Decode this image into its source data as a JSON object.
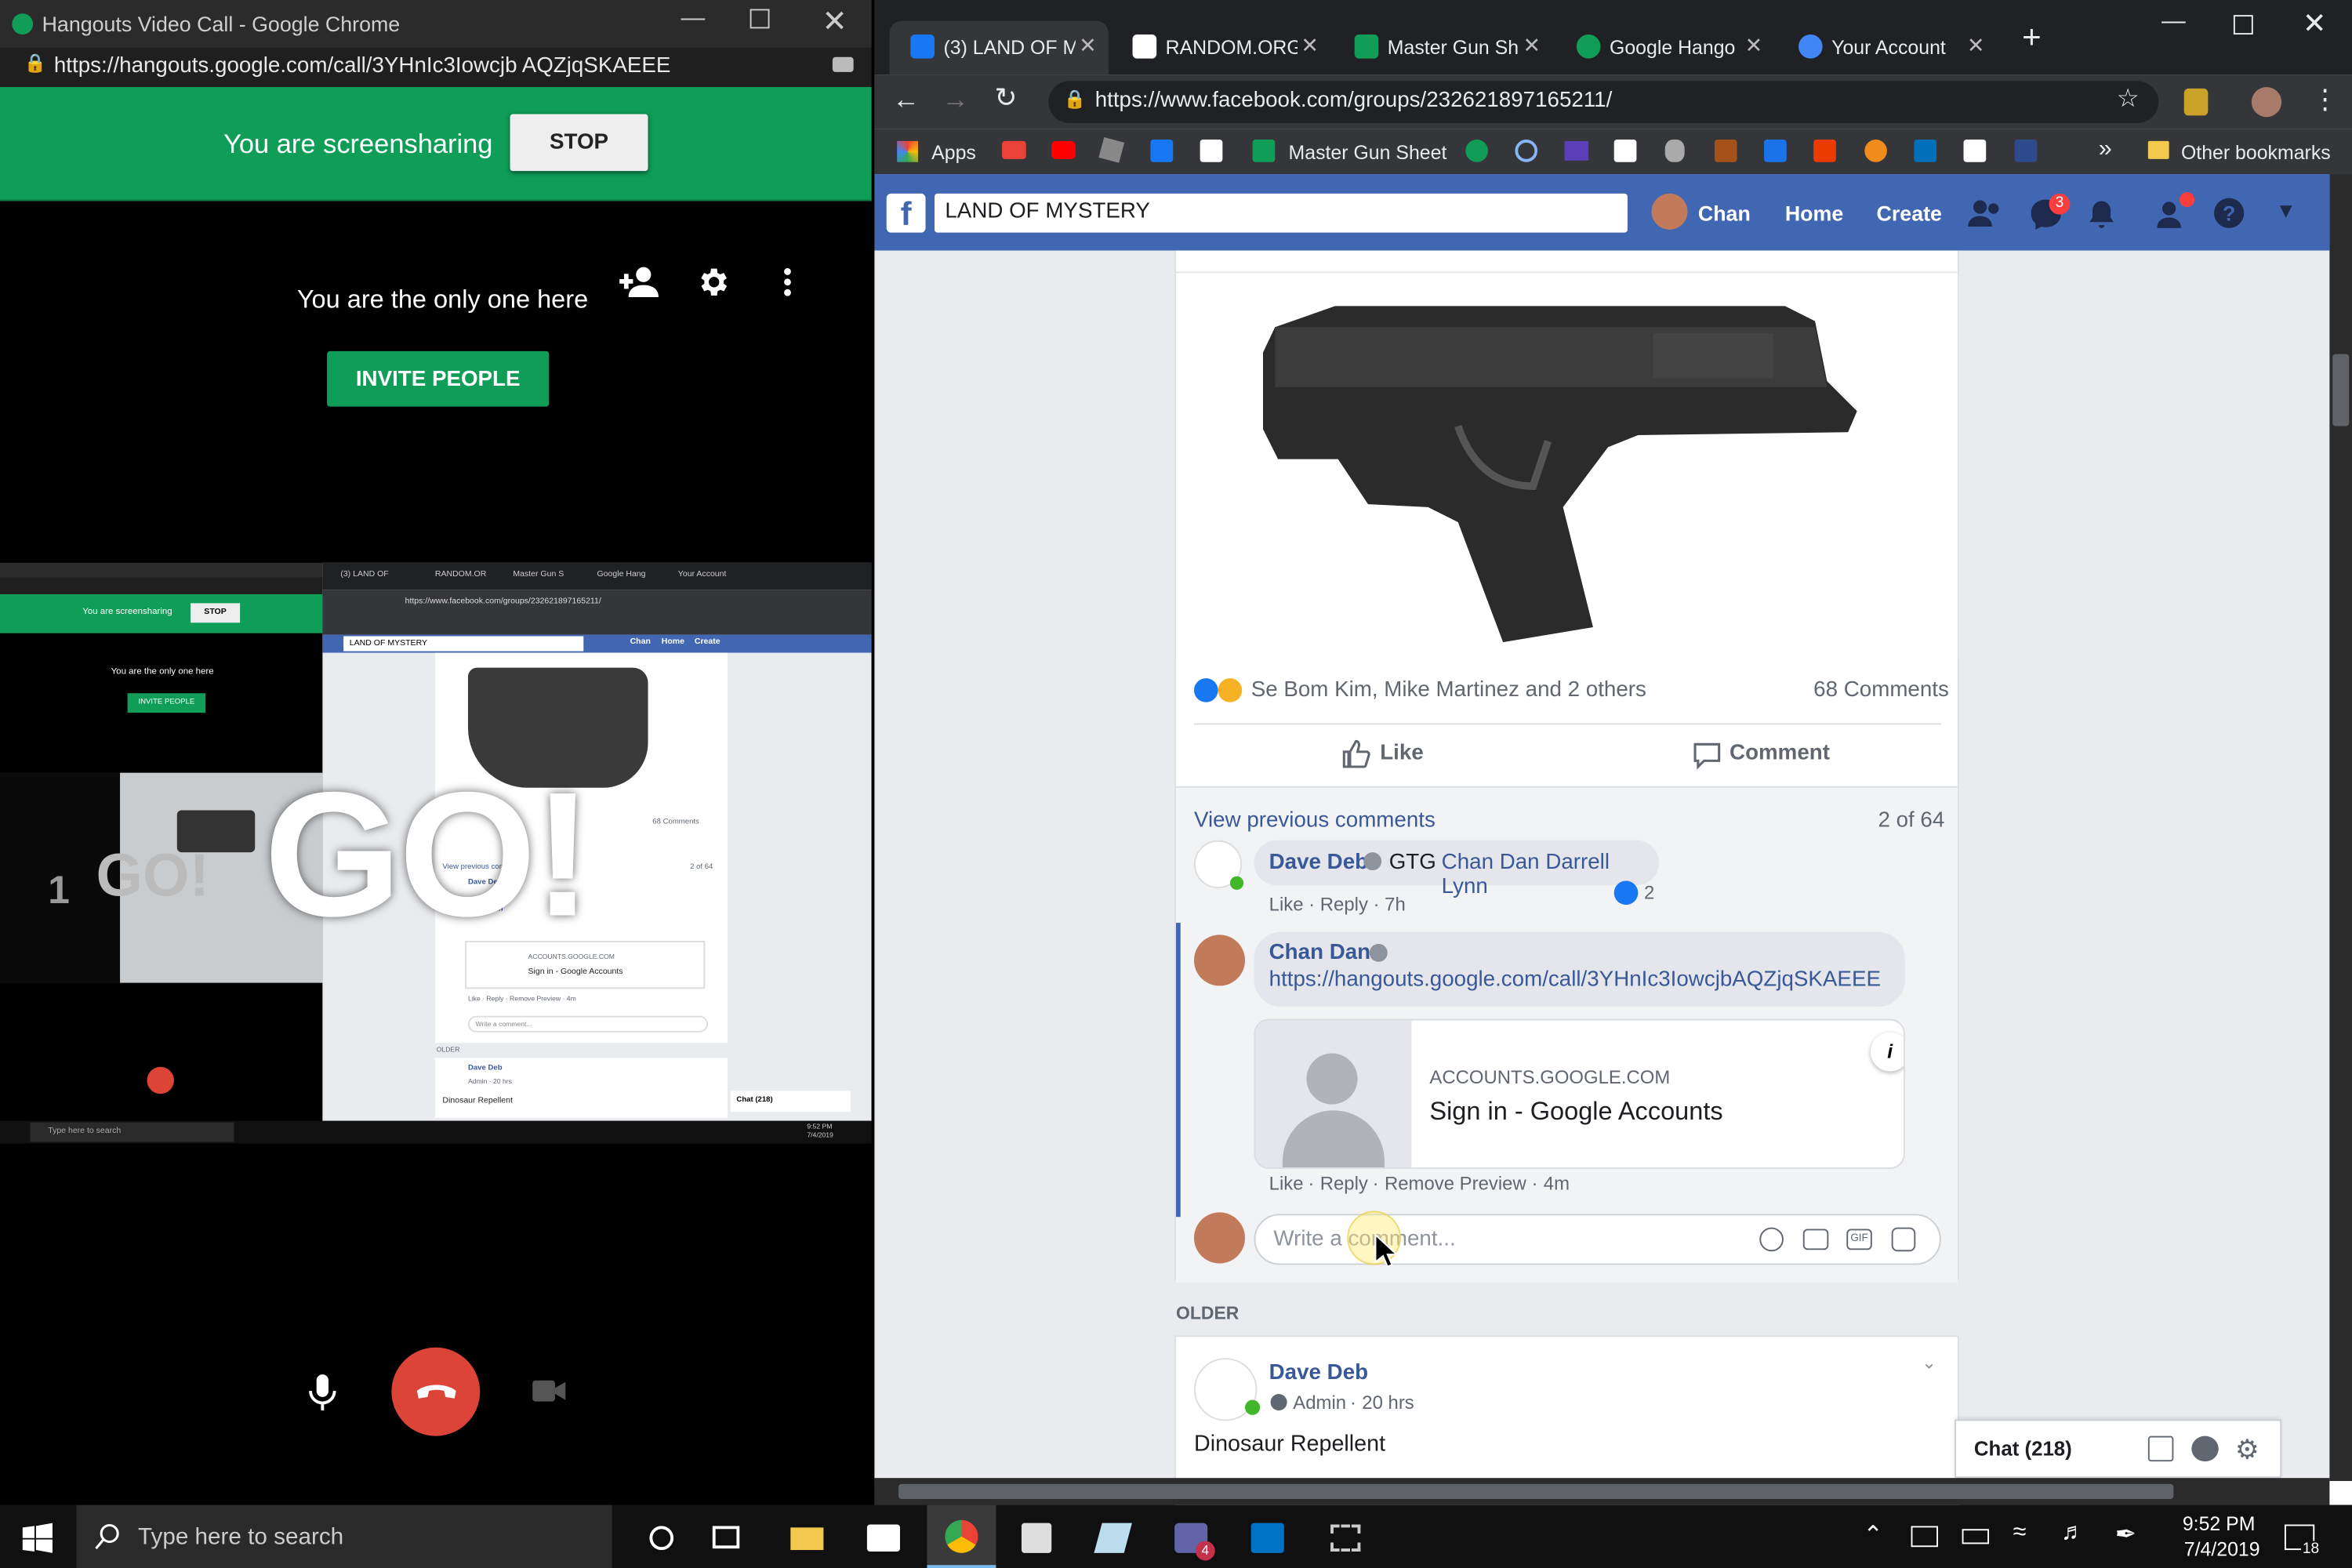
{
  "hangouts": {
    "window_title": "Hangouts Video Call - Google Chrome",
    "url": "https://hangouts.google.com/call/3YHnIc3Iowcjb AQZjqSKAEEE",
    "screenshare_text": "You are screensharing",
    "stop_label": "STOP",
    "only_one_text": "You are the only one here",
    "invite_label": "INVITE PEOPLE",
    "go_text": "GO!",
    "go_small": "GO!",
    "go_count": "1",
    "preview": {
      "screenshare": "You are screensharing",
      "stop": "STOP",
      "only_one": "You are the only one here",
      "invite": "INVITE PEOPLE",
      "tab_land": "(3) LAND OF",
      "tab_random": "RANDOM.OR",
      "tab_gun": "Master Gun S",
      "tab_hang": "Google Hang",
      "tab_acct": "Your Account",
      "url": "https://www.facebook.com/groups/232621897165211/",
      "fb_search": "LAND OF MYSTERY",
      "home": "Home",
      "create": "Create",
      "chan": "Chan",
      "comments": "68 Comments",
      "view_prev": "View previous comments",
      "count": "2 of 64",
      "dave": "Dave Deb",
      "chan_dan": "Chan Dan",
      "accounts": "ACCOUNTS.GOOGLE.COM",
      "signin": "Sign in - Google Accounts",
      "actions": "Like · Reply · Remove Preview · 4m",
      "write": "Write a comment...",
      "older": "OLDER",
      "admin": "Admin · 20 hrs",
      "dino": "Dinosaur Repellent",
      "chat": "Chat (218)",
      "taskbar_search": "Type here to search",
      "time": "9:52 PM",
      "date": "7/4/2019"
    }
  },
  "chrome": {
    "tabs": [
      {
        "label": "(3) LAND OF M",
        "icon": "facebook-icon",
        "color": "#1877f2"
      },
      {
        "label": "RANDOM.ORG",
        "icon": "random-org-icon",
        "color": "#ffffff"
      },
      {
        "label": "Master Gun Sh",
        "icon": "sheets-icon",
        "color": "#0f9d58"
      },
      {
        "label": "Google Hango",
        "icon": "hangouts-icon",
        "color": "#0f9d58"
      },
      {
        "label": "Your Account",
        "icon": "account-icon",
        "color": "#4285f4"
      }
    ],
    "url": "https://www.facebook.com/groups/232621897165211/",
    "bookmarks": {
      "apps": "Apps",
      "master_gun": "Master Gun Sheet",
      "more": "»",
      "other": "Other bookmarks"
    }
  },
  "facebook": {
    "search_value": "LAND OF MYSTERY",
    "user": "Chan",
    "home": "Home",
    "create": "Create",
    "messenger_badge": "3",
    "reactions_text": "Se Bom Kim, Mike Martinez and 2 others",
    "comments_count": "68 Comments",
    "like": "Like",
    "comment": "Comment",
    "view_previous": "View previous comments",
    "comment_range": "2 of 64",
    "c1": {
      "author": "Dave Deb",
      "text": "GTG",
      "mention": "Chan Dan Darrell Lynn",
      "actions": "Like · Reply · 7h",
      "reactions": "2"
    },
    "c2": {
      "author": "Chan Dan",
      "link": "https://hangouts.google.com/call/3YHnIc3IowcjbAQZjqSKAEEE",
      "domain": "ACCOUNTS.GOOGLE.COM",
      "title": "Sign in - Google Accounts",
      "like": "Like",
      "reply": "Reply",
      "remove": "Remove Preview",
      "time": "4m"
    },
    "write_placeholder": "Write a comment...",
    "older": "OLDER",
    "post2": {
      "author": "Dave Deb",
      "role": "Admin",
      "time": "20 hrs",
      "text": "Dinosaur Repellent"
    },
    "chat": "Chat (218)"
  },
  "taskbar": {
    "search_placeholder": "Type here to search",
    "time": "9:52 PM",
    "date": "7/4/2019",
    "teams_badge": "4",
    "notif_count": "18"
  }
}
